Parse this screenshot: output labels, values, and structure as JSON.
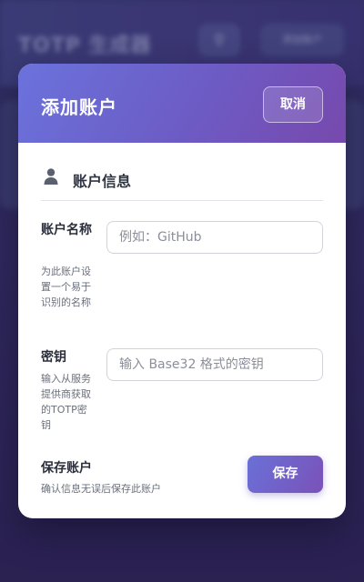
{
  "background_app": {
    "title": "TOTP 生成器",
    "icon_button": "search-icon",
    "button_label": "添加账户"
  },
  "modal": {
    "title": "添加账户",
    "cancel_label": "取消",
    "section": {
      "icon": "user-icon",
      "title": "账户信息"
    },
    "fields": [
      {
        "label": "账户名称",
        "help": "为此账户设置一个易于识别的名称",
        "value": "",
        "placeholder": "例如：GitHub"
      },
      {
        "label": "密钥",
        "help": "输入从服务提供商获取的TOTP密钥",
        "value": "",
        "placeholder": "输入 Base32 格式的密钥"
      }
    ],
    "save": {
      "label": "保存账户",
      "help": "确认信息无误后保存此账户",
      "button_label": "保存"
    }
  },
  "colors": {
    "header_gradient_start": "#6b72dc",
    "header_gradient_end": "#7749ad",
    "background": "#3a3370"
  }
}
